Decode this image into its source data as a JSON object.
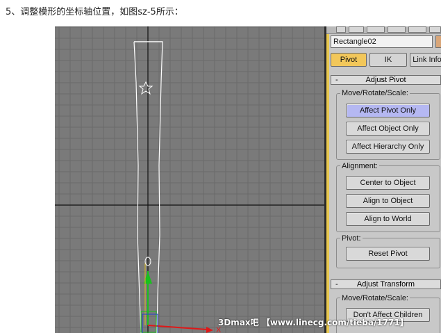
{
  "caption": "5、调整模形的坐标轴位置，如图sz-5所示：",
  "object_name": "Rectangle02",
  "tabs": [
    {
      "label": "Pivot",
      "active": true
    },
    {
      "label": "IK",
      "active": false
    },
    {
      "label": "Link Info",
      "active": false
    }
  ],
  "adjust_pivot": {
    "title": "Adjust Pivot",
    "toggle": "-",
    "move_group": {
      "label": "Move/Rotate/Scale:",
      "buttons": [
        "Affect Pivot Only",
        "Affect Object Only",
        "Affect Hierarchy Only"
      ],
      "active_index": 0
    },
    "alignment_group": {
      "label": "Alignment:",
      "buttons": [
        "Center to Object",
        "Align to Object",
        "Align to World"
      ]
    },
    "pivot_group": {
      "label": "Pivot:",
      "buttons": [
        "Reset Pivot"
      ]
    }
  },
  "adjust_transform": {
    "title": "Adjust Transform",
    "toggle": "-",
    "move_group": {
      "label": "Move/Rotate/Scale:",
      "buttons": [
        "Don't Affect Children"
      ]
    }
  },
  "viewport": {
    "axis_label": "X",
    "background": "#7a7a7a",
    "grid_color": "#6c6c6c",
    "object_color": "#ffffff"
  },
  "watermark": "3Dmax吧 【www.linecg.com/tieba/1771】",
  "colors": {
    "tab_active": "#f2c75a",
    "button_active": "#b5b8f2",
    "panel_bg": "#c8c8c8",
    "gizmo_green": "#19c01e",
    "gizmo_red": "#e01818"
  }
}
